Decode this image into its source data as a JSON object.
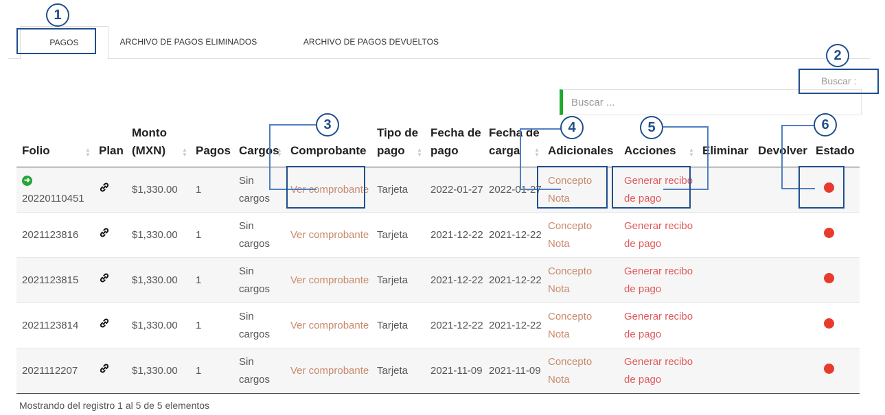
{
  "tabs": [
    {
      "label": "PAGOS",
      "active": true
    },
    {
      "label": "ARCHIVO DE PAGOS ELIMINADOS",
      "active": false
    },
    {
      "label": "ARCHIVO DE PAGOS DEVUELTOS",
      "active": false
    }
  ],
  "search": {
    "label": "Buscar :",
    "placeholder": "Buscar ..."
  },
  "columns": [
    "Folio",
    "Plan",
    "Monto (MXN)",
    "Pagos",
    "Cargos",
    "Comprobante",
    "Tipo de pago",
    "Fecha de pago",
    "Fecha de carga",
    "Adicionales",
    "Acciones",
    "Eliminar",
    "Devolver",
    "Estado"
  ],
  "rows": [
    {
      "folio": "20220110451",
      "monto": "$1,330.00",
      "pagos": "1",
      "cargos": "Sin cargos",
      "comprobante": "Ver comprobante",
      "tipo": "Tarjeta",
      "fecha_pago": "2022-01-27",
      "fecha_carga": "2022-01-27",
      "adicional_1": "Concepto",
      "adicional_2": "Nota",
      "accion": "Generar recibo de pago"
    },
    {
      "folio": "2021123816",
      "monto": "$1,330.00",
      "pagos": "1",
      "cargos": "Sin cargos",
      "comprobante": "Ver comprobante",
      "tipo": "Tarjeta",
      "fecha_pago": "2021-12-22",
      "fecha_carga": "2021-12-22",
      "adicional_1": "Concepto",
      "adicional_2": "Nota",
      "accion": "Generar recibo de pago"
    },
    {
      "folio": "2021123815",
      "monto": "$1,330.00",
      "pagos": "1",
      "cargos": "Sin cargos",
      "comprobante": "Ver comprobante",
      "tipo": "Tarjeta",
      "fecha_pago": "2021-12-22",
      "fecha_carga": "2021-12-22",
      "adicional_1": "Concepto",
      "adicional_2": "Nota",
      "accion": "Generar recibo de pago"
    },
    {
      "folio": "2021123814",
      "monto": "$1,330.00",
      "pagos": "1",
      "cargos": "Sin cargos",
      "comprobante": "Ver comprobante",
      "tipo": "Tarjeta",
      "fecha_pago": "2021-12-22",
      "fecha_carga": "2021-12-22",
      "adicional_1": "Concepto",
      "adicional_2": "Nota",
      "accion": "Generar recibo de pago"
    },
    {
      "folio": "2021112207",
      "monto": "$1,330.00",
      "pagos": "1",
      "cargos": "Sin cargos",
      "comprobante": "Ver comprobante",
      "tipo": "Tarjeta",
      "fecha_pago": "2021-11-09",
      "fecha_carga": "2021-11-09",
      "adicional_1": "Concepto",
      "adicional_2": "Nota",
      "accion": "Generar recibo de pago"
    }
  ],
  "footer": "Mostrando del registro 1 al 5 de 5 elementos",
  "annotations": [
    "1",
    "2",
    "3",
    "4",
    "5",
    "6"
  ],
  "colors": {
    "accent": "#1f4e8c",
    "status_dot": "#e83b2e",
    "search_bar": "#1faa2b",
    "go_icon": "#27a53a"
  }
}
